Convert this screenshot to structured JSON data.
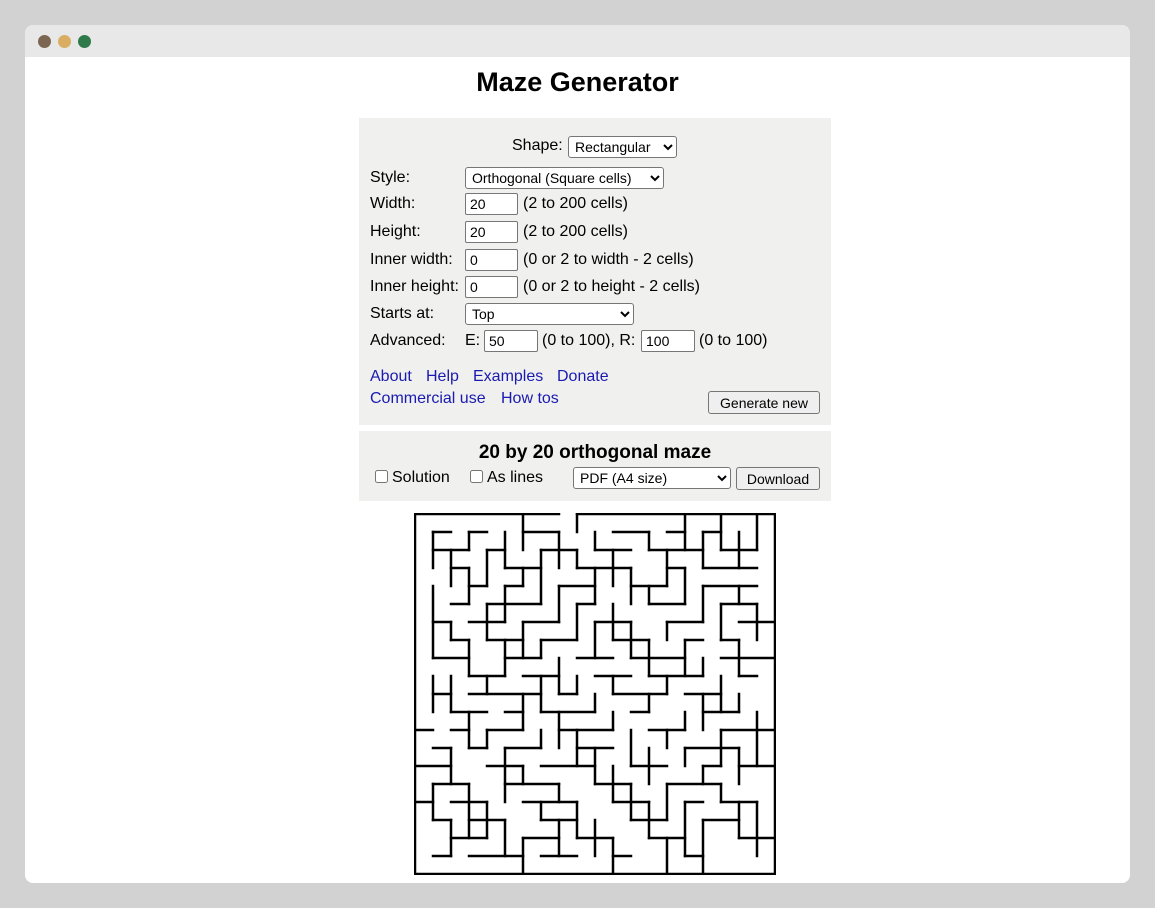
{
  "window": {
    "controls": [
      "#7b6651",
      "#d9ae62",
      "#2f7a4a"
    ]
  },
  "page": {
    "title": "Maze Generator"
  },
  "settings": {
    "shape_label": "Shape:",
    "shape_value": "Rectangular",
    "style_label": "Style:",
    "style_value": "Orthogonal (Square cells)",
    "width_label": "Width:",
    "width_value": "20",
    "width_hint": "(2 to 200 cells)",
    "height_label": "Height:",
    "height_value": "20",
    "height_hint": "(2 to 200 cells)",
    "inner_width_label": "Inner width:",
    "inner_width_value": "0",
    "inner_width_hint": "(0 or 2 to width - 2 cells)",
    "inner_height_label": "Inner height:",
    "inner_height_value": "0",
    "inner_height_hint": "(0 or 2 to height - 2 cells)",
    "starts_label": "Starts at:",
    "starts_value": "Top",
    "advanced_label": "Advanced:",
    "e_label": "E:",
    "e_value": "50",
    "e_hint": "(0 to 100), R:",
    "r_value": "100",
    "r_hint": "(0 to 100)"
  },
  "links": [
    "About",
    "Help",
    "Examples",
    "Donate",
    "Commercial use",
    "How tos"
  ],
  "generate_button": "Generate new",
  "result": {
    "title": "20 by 20 orthogonal maze",
    "solution_label": "Solution",
    "as_lines_label": "As lines",
    "format_value": "PDF (A4 size)",
    "download_button": "Download"
  },
  "maze": {
    "cols": 20,
    "rows": 20,
    "outer_walls": [
      [
        0,
        0,
        8,
        0
      ],
      [
        9,
        0,
        20,
        0
      ],
      [
        0,
        0,
        0,
        20
      ],
      [
        20,
        0,
        20,
        20
      ],
      [
        0,
        20,
        20,
        20
      ]
    ],
    "walls": [
      [
        1,
        1,
        2,
        1
      ],
      [
        3,
        1,
        4,
        1
      ],
      [
        6,
        1,
        8,
        1
      ],
      [
        11,
        1,
        13,
        1
      ],
      [
        14,
        1,
        15,
        1
      ],
      [
        16,
        1,
        17,
        1
      ],
      [
        1,
        2,
        3,
        2
      ],
      [
        4,
        2,
        5,
        2
      ],
      [
        7,
        2,
        9,
        2
      ],
      [
        10,
        2,
        12,
        2
      ],
      [
        13,
        2,
        16,
        2
      ],
      [
        17,
        2,
        19,
        2
      ],
      [
        2,
        3,
        3,
        3
      ],
      [
        5,
        3,
        7,
        3
      ],
      [
        9,
        3,
        12,
        3
      ],
      [
        14,
        3,
        15,
        3
      ],
      [
        16,
        3,
        19,
        3
      ],
      [
        3,
        4,
        4,
        4
      ],
      [
        5,
        4,
        6,
        4
      ],
      [
        8,
        4,
        10,
        4
      ],
      [
        12,
        4,
        14,
        4
      ],
      [
        16,
        4,
        19,
        4
      ],
      [
        2,
        5,
        3,
        5
      ],
      [
        4,
        5,
        7,
        5
      ],
      [
        9,
        5,
        10,
        5
      ],
      [
        13,
        5,
        15,
        5
      ],
      [
        17,
        5,
        19,
        5
      ],
      [
        1,
        6,
        2,
        6
      ],
      [
        3,
        6,
        5,
        6
      ],
      [
        6,
        6,
        8,
        6
      ],
      [
        10,
        6,
        12,
        6
      ],
      [
        14,
        6,
        16,
        6
      ],
      [
        18,
        6,
        20,
        6
      ],
      [
        2,
        7,
        3,
        7
      ],
      [
        4,
        7,
        6,
        7
      ],
      [
        7,
        7,
        9,
        7
      ],
      [
        11,
        7,
        13,
        7
      ],
      [
        15,
        7,
        16,
        7
      ],
      [
        17,
        7,
        18,
        7
      ],
      [
        1,
        8,
        3,
        8
      ],
      [
        5,
        8,
        7,
        8
      ],
      [
        9,
        8,
        11,
        8
      ],
      [
        12,
        8,
        15,
        8
      ],
      [
        17,
        8,
        20,
        8
      ],
      [
        3,
        9,
        5,
        9
      ],
      [
        6,
        9,
        8,
        9
      ],
      [
        10,
        9,
        12,
        9
      ],
      [
        13,
        9,
        16,
        9
      ],
      [
        18,
        9,
        19,
        9
      ],
      [
        1,
        10,
        2,
        10
      ],
      [
        3,
        10,
        7,
        10
      ],
      [
        8,
        10,
        9,
        10
      ],
      [
        11,
        10,
        14,
        10
      ],
      [
        15,
        10,
        17,
        10
      ],
      [
        2,
        11,
        4,
        11
      ],
      [
        5,
        11,
        6,
        11
      ],
      [
        7,
        11,
        10,
        11
      ],
      [
        12,
        11,
        13,
        11
      ],
      [
        16,
        11,
        18,
        11
      ],
      [
        0,
        12,
        1,
        12
      ],
      [
        2,
        12,
        3,
        12
      ],
      [
        4,
        12,
        6,
        12
      ],
      [
        8,
        12,
        11,
        12
      ],
      [
        13,
        12,
        15,
        12
      ],
      [
        17,
        12,
        20,
        12
      ],
      [
        1,
        13,
        2,
        13
      ],
      [
        3,
        13,
        4,
        13
      ],
      [
        5,
        13,
        7,
        13
      ],
      [
        9,
        13,
        11,
        13
      ],
      [
        15,
        13,
        18,
        13
      ],
      [
        0,
        14,
        2,
        14
      ],
      [
        4,
        14,
        6,
        14
      ],
      [
        7,
        14,
        10,
        14
      ],
      [
        12,
        14,
        14,
        14
      ],
      [
        16,
        14,
        17,
        14
      ],
      [
        18,
        14,
        20,
        14
      ],
      [
        1,
        15,
        3,
        15
      ],
      [
        5,
        15,
        8,
        15
      ],
      [
        10,
        15,
        12,
        15
      ],
      [
        14,
        15,
        17,
        15
      ],
      [
        0,
        16,
        1,
        16
      ],
      [
        2,
        16,
        4,
        16
      ],
      [
        6,
        16,
        9,
        16
      ],
      [
        11,
        16,
        13,
        16
      ],
      [
        15,
        16,
        16,
        16
      ],
      [
        17,
        16,
        19,
        16
      ],
      [
        1,
        17,
        2,
        17
      ],
      [
        3,
        17,
        5,
        17
      ],
      [
        7,
        17,
        9,
        17
      ],
      [
        12,
        17,
        14,
        17
      ],
      [
        16,
        17,
        18,
        17
      ],
      [
        2,
        18,
        4,
        18
      ],
      [
        6,
        18,
        8,
        18
      ],
      [
        9,
        18,
        11,
        18
      ],
      [
        13,
        18,
        15,
        18
      ],
      [
        18,
        18,
        20,
        18
      ],
      [
        1,
        19,
        2,
        19
      ],
      [
        3,
        19,
        6,
        19
      ],
      [
        7,
        19,
        9,
        19
      ],
      [
        11,
        19,
        12,
        19
      ],
      [
        15,
        19,
        16,
        19
      ],
      [
        1,
        1,
        1,
        3
      ],
      [
        1,
        4,
        1,
        8
      ],
      [
        1,
        9,
        1,
        11
      ],
      [
        1,
        15,
        1,
        17
      ],
      [
        2,
        2,
        2,
        4
      ],
      [
        2,
        6,
        2,
        7
      ],
      [
        2,
        9,
        2,
        11
      ],
      [
        2,
        13,
        2,
        15
      ],
      [
        2,
        17,
        2,
        19
      ],
      [
        3,
        1,
        3,
        2
      ],
      [
        3,
        3,
        3,
        5
      ],
      [
        3,
        7,
        3,
        9
      ],
      [
        3,
        11,
        3,
        13
      ],
      [
        3,
        15,
        3,
        18
      ],
      [
        4,
        2,
        4,
        4
      ],
      [
        4,
        5,
        4,
        7
      ],
      [
        4,
        9,
        4,
        10
      ],
      [
        4,
        12,
        4,
        13
      ],
      [
        4,
        16,
        4,
        18
      ],
      [
        5,
        1,
        5,
        3
      ],
      [
        5,
        4,
        5,
        6
      ],
      [
        5,
        7,
        5,
        9
      ],
      [
        5,
        13,
        5,
        16
      ],
      [
        5,
        17,
        5,
        19
      ],
      [
        6,
        0,
        6,
        2
      ],
      [
        6,
        3,
        6,
        4
      ],
      [
        6,
        6,
        6,
        8
      ],
      [
        6,
        10,
        6,
        12
      ],
      [
        6,
        14,
        6,
        15
      ],
      [
        6,
        18,
        6,
        20
      ],
      [
        7,
        2,
        7,
        5
      ],
      [
        7,
        7,
        7,
        8
      ],
      [
        7,
        9,
        7,
        11
      ],
      [
        7,
        12,
        7,
        13
      ],
      [
        7,
        16,
        7,
        17
      ],
      [
        8,
        1,
        8,
        3
      ],
      [
        8,
        4,
        8,
        6
      ],
      [
        8,
        8,
        8,
        10
      ],
      [
        8,
        11,
        8,
        13
      ],
      [
        8,
        15,
        8,
        16
      ],
      [
        8,
        17,
        8,
        19
      ],
      [
        9,
        0,
        9,
        1
      ],
      [
        9,
        2,
        9,
        3
      ],
      [
        9,
        5,
        9,
        7
      ],
      [
        9,
        9,
        9,
        10
      ],
      [
        9,
        12,
        9,
        14
      ],
      [
        9,
        16,
        9,
        18
      ],
      [
        10,
        1,
        10,
        2
      ],
      [
        10,
        3,
        10,
        5
      ],
      [
        10,
        6,
        10,
        8
      ],
      [
        10,
        10,
        10,
        11
      ],
      [
        10,
        13,
        10,
        15
      ],
      [
        10,
        17,
        10,
        19
      ],
      [
        11,
        2,
        11,
        4
      ],
      [
        11,
        5,
        11,
        7
      ],
      [
        11,
        9,
        11,
        10
      ],
      [
        11,
        11,
        11,
        12
      ],
      [
        11,
        14,
        11,
        16
      ],
      [
        11,
        18,
        11,
        20
      ],
      [
        12,
        3,
        12,
        5
      ],
      [
        12,
        6,
        12,
        8
      ],
      [
        12,
        12,
        12,
        14
      ],
      [
        12,
        15,
        12,
        17
      ],
      [
        13,
        1,
        13,
        2
      ],
      [
        13,
        4,
        13,
        5
      ],
      [
        13,
        7,
        13,
        9
      ],
      [
        13,
        10,
        13,
        11
      ],
      [
        13,
        13,
        13,
        15
      ],
      [
        13,
        16,
        13,
        18
      ],
      [
        14,
        2,
        14,
        4
      ],
      [
        14,
        6,
        14,
        7
      ],
      [
        14,
        9,
        14,
        10
      ],
      [
        14,
        12,
        14,
        13
      ],
      [
        14,
        15,
        14,
        17
      ],
      [
        14,
        18,
        14,
        20
      ],
      [
        15,
        0,
        15,
        2
      ],
      [
        15,
        3,
        15,
        5
      ],
      [
        15,
        7,
        15,
        9
      ],
      [
        15,
        11,
        15,
        12
      ],
      [
        15,
        13,
        15,
        14
      ],
      [
        15,
        16,
        15,
        19
      ],
      [
        16,
        1,
        16,
        3
      ],
      [
        16,
        4,
        16,
        6
      ],
      [
        16,
        8,
        16,
        9
      ],
      [
        16,
        10,
        16,
        12
      ],
      [
        16,
        14,
        16,
        15
      ],
      [
        16,
        17,
        16,
        20
      ],
      [
        17,
        0,
        17,
        2
      ],
      [
        17,
        5,
        17,
        7
      ],
      [
        17,
        9,
        17,
        11
      ],
      [
        17,
        12,
        17,
        14
      ],
      [
        17,
        15,
        17,
        16
      ],
      [
        18,
        1,
        18,
        3
      ],
      [
        18,
        4,
        18,
        5
      ],
      [
        18,
        7,
        18,
        9
      ],
      [
        18,
        10,
        18,
        11
      ],
      [
        18,
        13,
        18,
        15
      ],
      [
        18,
        16,
        18,
        18
      ],
      [
        19,
        0,
        19,
        2
      ],
      [
        19,
        5,
        19,
        7
      ],
      [
        19,
        11,
        19,
        14
      ],
      [
        19,
        16,
        19,
        19
      ]
    ]
  }
}
